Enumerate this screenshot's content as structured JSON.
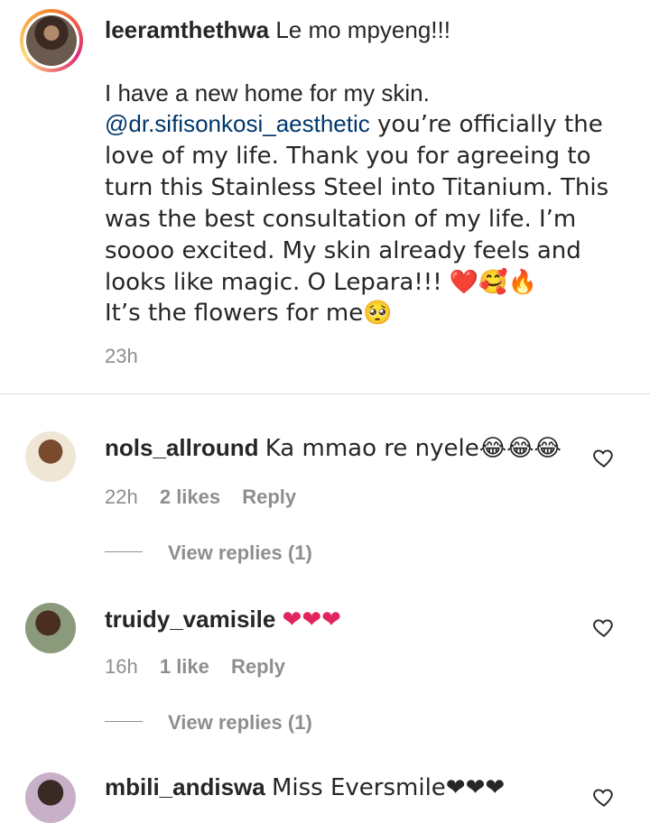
{
  "post": {
    "username": "leeramthethwa",
    "title_text": "Le mo mpyeng!!!",
    "body_line1": "I have a new home for my skin.",
    "mention": "@dr.sifisonkosi_aesthetic",
    "body_rest": " you’re officially the love of my life. Thank you for agreeing to turn this Stainless Steel into Titanium. This was the best consultation of my life. I’m soooo excited. My skin already feels and looks like magic. O Lepara!!! ❤️🥰🔥",
    "body_last": "It’s the flowers for me🥺",
    "time": "23h"
  },
  "comments": [
    {
      "username": "nols_allround",
      "text": "Ka mmao re nyele😂😂😂",
      "time": "22h",
      "likes": "2 likes",
      "reply": "Reply",
      "view_replies": "View replies (1)"
    },
    {
      "username": "truidy_vamisile",
      "text": "❤❤❤",
      "time": "16h",
      "likes": "1 like",
      "reply": "Reply",
      "view_replies": "View replies (1)"
    },
    {
      "username": "mbili_andiswa",
      "text": "Miss Eversmile❤❤❤"
    }
  ],
  "icons": {
    "heart_outline": "heart-outline-icon"
  },
  "colors": {
    "mention": "#00376b",
    "meta": "#8e8e8e",
    "divider": "#dbdbdb",
    "text": "#262626"
  }
}
